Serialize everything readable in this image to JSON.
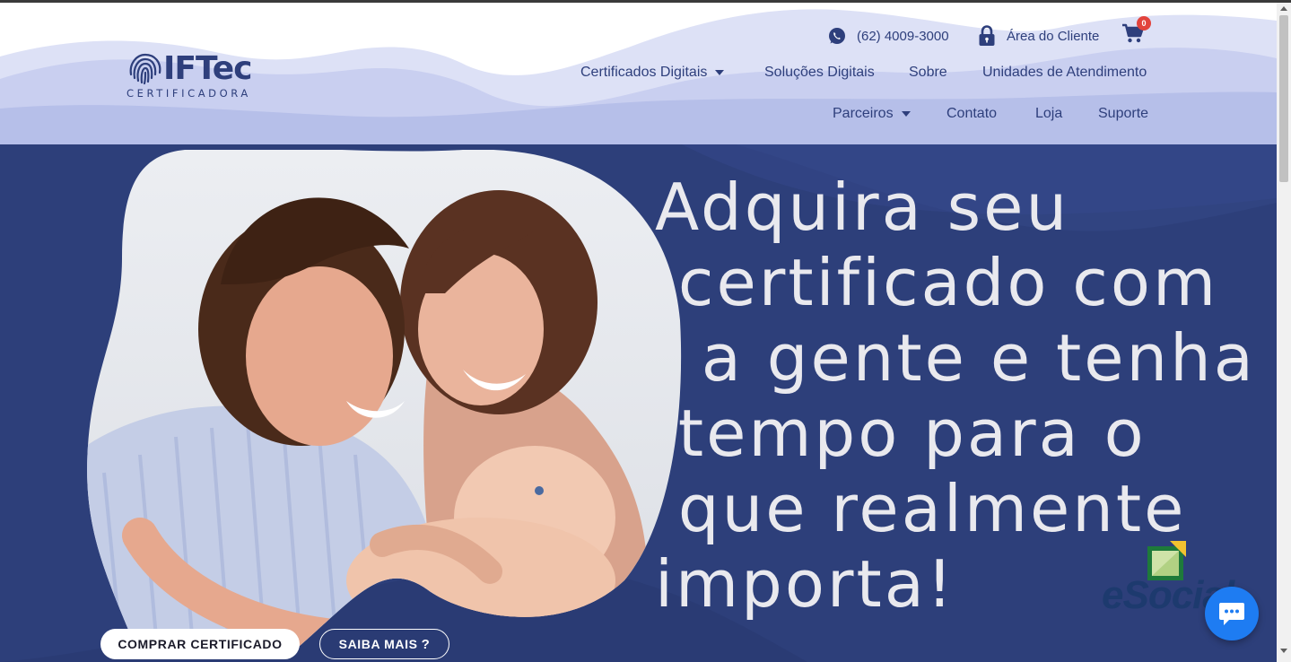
{
  "brand": {
    "name": "IFTec",
    "tagline": "CERTIFICADORA"
  },
  "topbar": {
    "phone": "(62) 4009-3000",
    "client_area": "Área do Cliente",
    "cart_count": "0"
  },
  "nav": {
    "row1": [
      {
        "label": "Certificados Digitais",
        "has_dropdown": true
      },
      {
        "label": "Soluções Digitais",
        "has_dropdown": false
      },
      {
        "label": "Sobre",
        "has_dropdown": false
      },
      {
        "label": "Unidades de Atendimento",
        "has_dropdown": false
      }
    ],
    "row2": [
      {
        "label": "Parceiros",
        "has_dropdown": true
      },
      {
        "label": "Contato",
        "has_dropdown": false
      },
      {
        "label": "Loja",
        "has_dropdown": false
      },
      {
        "label": "Suporte",
        "has_dropdown": false
      }
    ]
  },
  "hero": {
    "headline_lines": [
      "Adquira seu",
      " certificado com",
      "  a gente e tenha",
      " tempo para o",
      " que realmente",
      "importa!"
    ],
    "buy_button": "COMPRAR CERTIFICADO",
    "more_button": "SAIBA MAIS",
    "more_icon": "?",
    "partner_logo": "eSocial"
  },
  "icons": {
    "phone": "whatsapp-icon",
    "client_area": "lock-icon",
    "cart": "cart-icon",
    "chat": "chat-icon"
  },
  "colors": {
    "brand_blue": "#2e3f7c",
    "hero_bg": "#2d3f7a",
    "wave_light": "#c9cff0",
    "accent_chat": "#1e7cf2",
    "badge_red": "#e2433c"
  }
}
